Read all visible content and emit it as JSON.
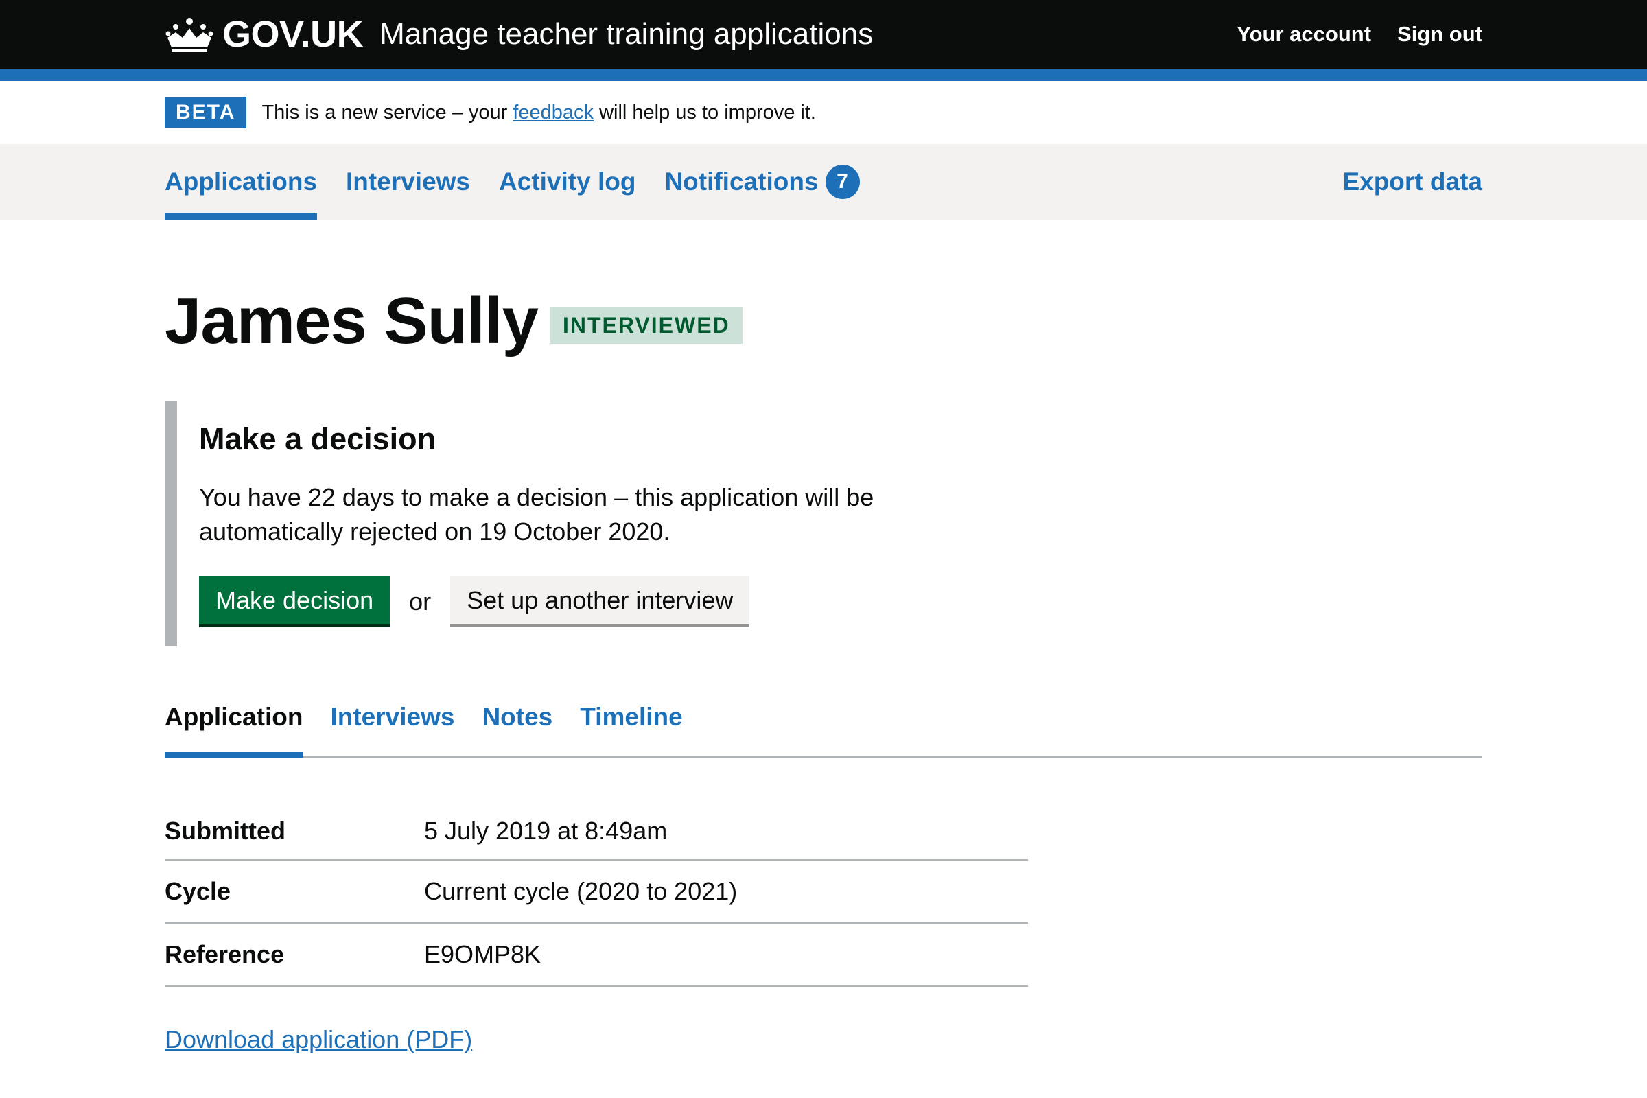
{
  "header": {
    "logo_text": "GOV.UK",
    "service_name": "Manage teacher training applications",
    "links": {
      "account": "Your account",
      "sign_out": "Sign out"
    }
  },
  "phase_banner": {
    "tag": "BETA",
    "text_before": "This is a new service – your ",
    "link": "feedback",
    "text_after": " will help us to improve it."
  },
  "primary_nav": {
    "items": [
      "Applications",
      "Interviews",
      "Activity log",
      "Notifications"
    ],
    "notifications_count": "7",
    "export": "Export data"
  },
  "page": {
    "title": "James Sully",
    "status": "INTERVIEWED"
  },
  "decision": {
    "heading": "Make a decision",
    "body": "You have 22 days to make a decision – this application will be automatically rejected on 19 October 2020.",
    "primary_button": "Make decision",
    "or": "or",
    "secondary_button": "Set up another interview"
  },
  "tabs": [
    "Application",
    "Interviews",
    "Notes",
    "Timeline"
  ],
  "summary": [
    {
      "key": "Submitted",
      "value": "5 July 2019 at 8:49am"
    },
    {
      "key": "Cycle",
      "value": "Current cycle (2020 to 2021)"
    },
    {
      "key": "Reference",
      "value": "E9OMP8K"
    }
  ],
  "download_link": "Download application (PDF)",
  "colors": {
    "header_bg": "#0b0c0c",
    "brand_blue": "#1d70b8",
    "nav_bg": "#f3f2f1",
    "primary_green": "#00703c",
    "status_tag_bg": "#cce2d8",
    "status_tag_text": "#005a30"
  }
}
